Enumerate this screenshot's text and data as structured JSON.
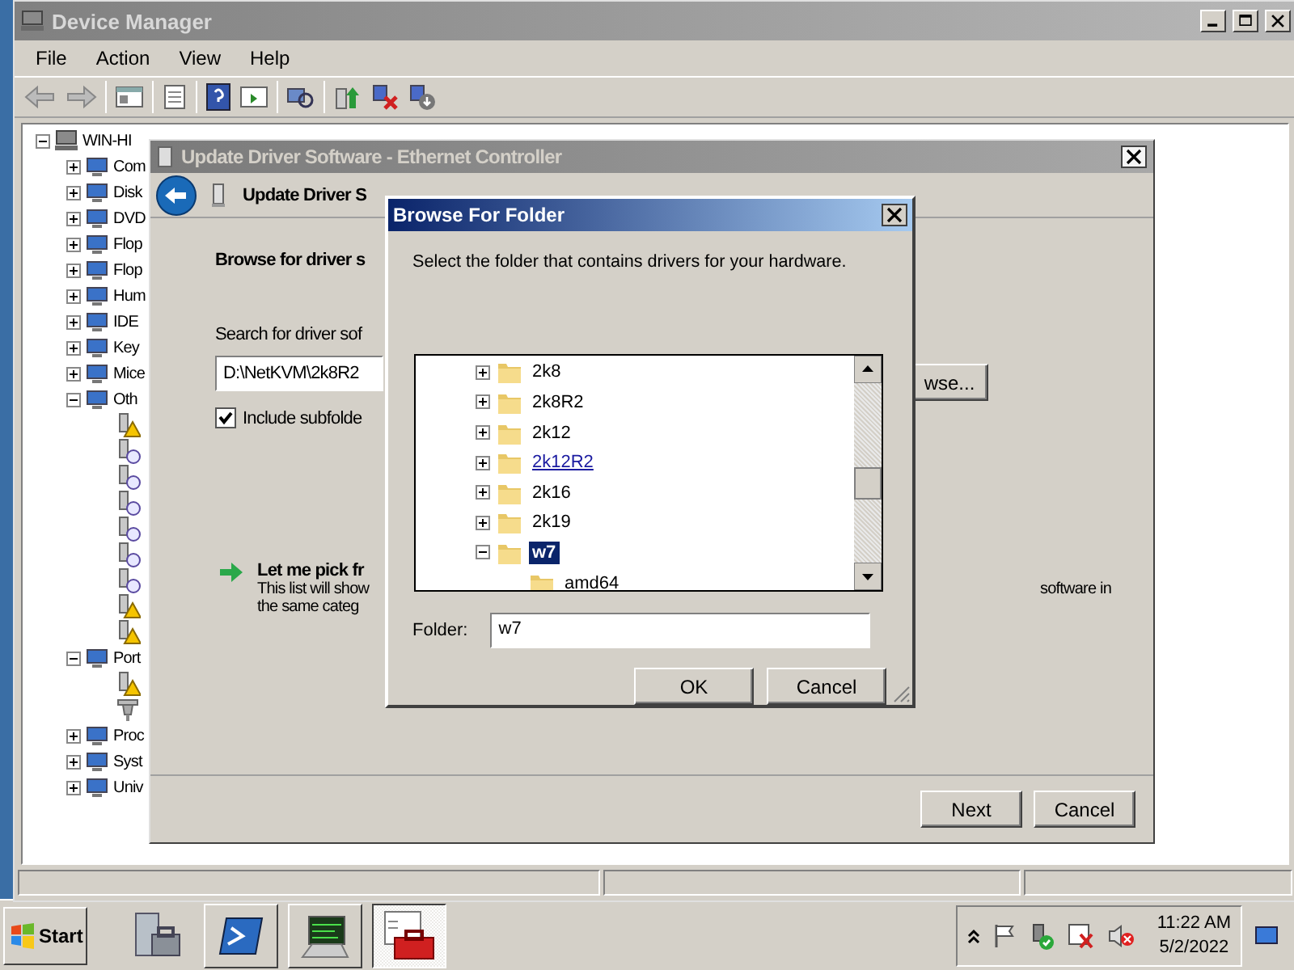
{
  "device_manager": {
    "title": "Device Manager",
    "menu": [
      "File",
      "Action",
      "View",
      "Help"
    ],
    "tree": {
      "label": "WIN-HI",
      "expanded": true,
      "children": [
        {
          "label": "Com",
          "expanded": false
        },
        {
          "label": "Disk",
          "expanded": false
        },
        {
          "label": "DVD",
          "expanded": false
        },
        {
          "label": "Flop",
          "expanded": false
        },
        {
          "label": "Flop",
          "expanded": false
        },
        {
          "label": "Hum",
          "expanded": false
        },
        {
          "label": "IDE",
          "expanded": false
        },
        {
          "label": "Key",
          "expanded": false
        },
        {
          "label": "Mice",
          "expanded": false
        },
        {
          "label": "Oth",
          "expanded": true,
          "children": [
            {
              "kind": "warning"
            },
            {
              "kind": "unknown"
            },
            {
              "kind": "unknown"
            },
            {
              "kind": "unknown"
            },
            {
              "kind": "unknown"
            },
            {
              "kind": "unknown"
            },
            {
              "kind": "unknown"
            },
            {
              "kind": "warning"
            },
            {
              "kind": "warning"
            }
          ]
        },
        {
          "label": "Port",
          "expanded": true,
          "children": [
            {
              "kind": "warning"
            },
            {
              "kind": "ok"
            }
          ]
        },
        {
          "label": "Proc",
          "expanded": false
        },
        {
          "label": "Syst",
          "expanded": false
        },
        {
          "label": "Univ",
          "expanded": false
        }
      ]
    }
  },
  "wizard": {
    "title": "Update Driver Software - Ethernet Controller",
    "header": "Update Driver S",
    "heading": "Browse for driver s",
    "search_label": "Search for driver sof",
    "path_value": "D:\\NetKVM\\2k8R2",
    "browse_button": "wse...",
    "include_subfolders": {
      "label": "Include subfolde",
      "checked": true
    },
    "pick_title": "Let me pick fr",
    "pick_line_1": "This list will show",
    "pick_line_1_end": "software in",
    "pick_line_2": "the same categ",
    "buttons": [
      "Next",
      "Cancel"
    ]
  },
  "browse": {
    "title": "Browse For Folder",
    "prompt": "Select the folder that contains drivers for your hardware.",
    "folders": [
      {
        "label": "2k8",
        "expanded": false,
        "selected": false,
        "hovered": false
      },
      {
        "label": "2k8R2",
        "expanded": false,
        "selected": false,
        "hovered": false
      },
      {
        "label": "2k12",
        "expanded": false,
        "selected": false,
        "hovered": false
      },
      {
        "label": "2k12R2",
        "expanded": false,
        "selected": false,
        "hovered": true
      },
      {
        "label": "2k16",
        "expanded": false,
        "selected": false,
        "hovered": false
      },
      {
        "label": "2k19",
        "expanded": false,
        "selected": false,
        "hovered": false
      },
      {
        "label": "w7",
        "expanded": true,
        "selected": true,
        "hovered": false,
        "children": [
          {
            "label": "amd64",
            "selected": false,
            "hovered": false
          }
        ]
      }
    ],
    "folder_label": "Folder:",
    "folder_value": "w7",
    "buttons": [
      "OK",
      "Cancel"
    ]
  },
  "taskbar": {
    "start": "Start",
    "apps": [
      {
        "kind": "server",
        "selected": false
      },
      {
        "kind": "terminal",
        "selected": false
      },
      {
        "kind": "monitor",
        "selected": false
      },
      {
        "kind": "toolbox",
        "selected": true
      }
    ],
    "time": "11:22 AM",
    "date": "5/2/2022"
  }
}
